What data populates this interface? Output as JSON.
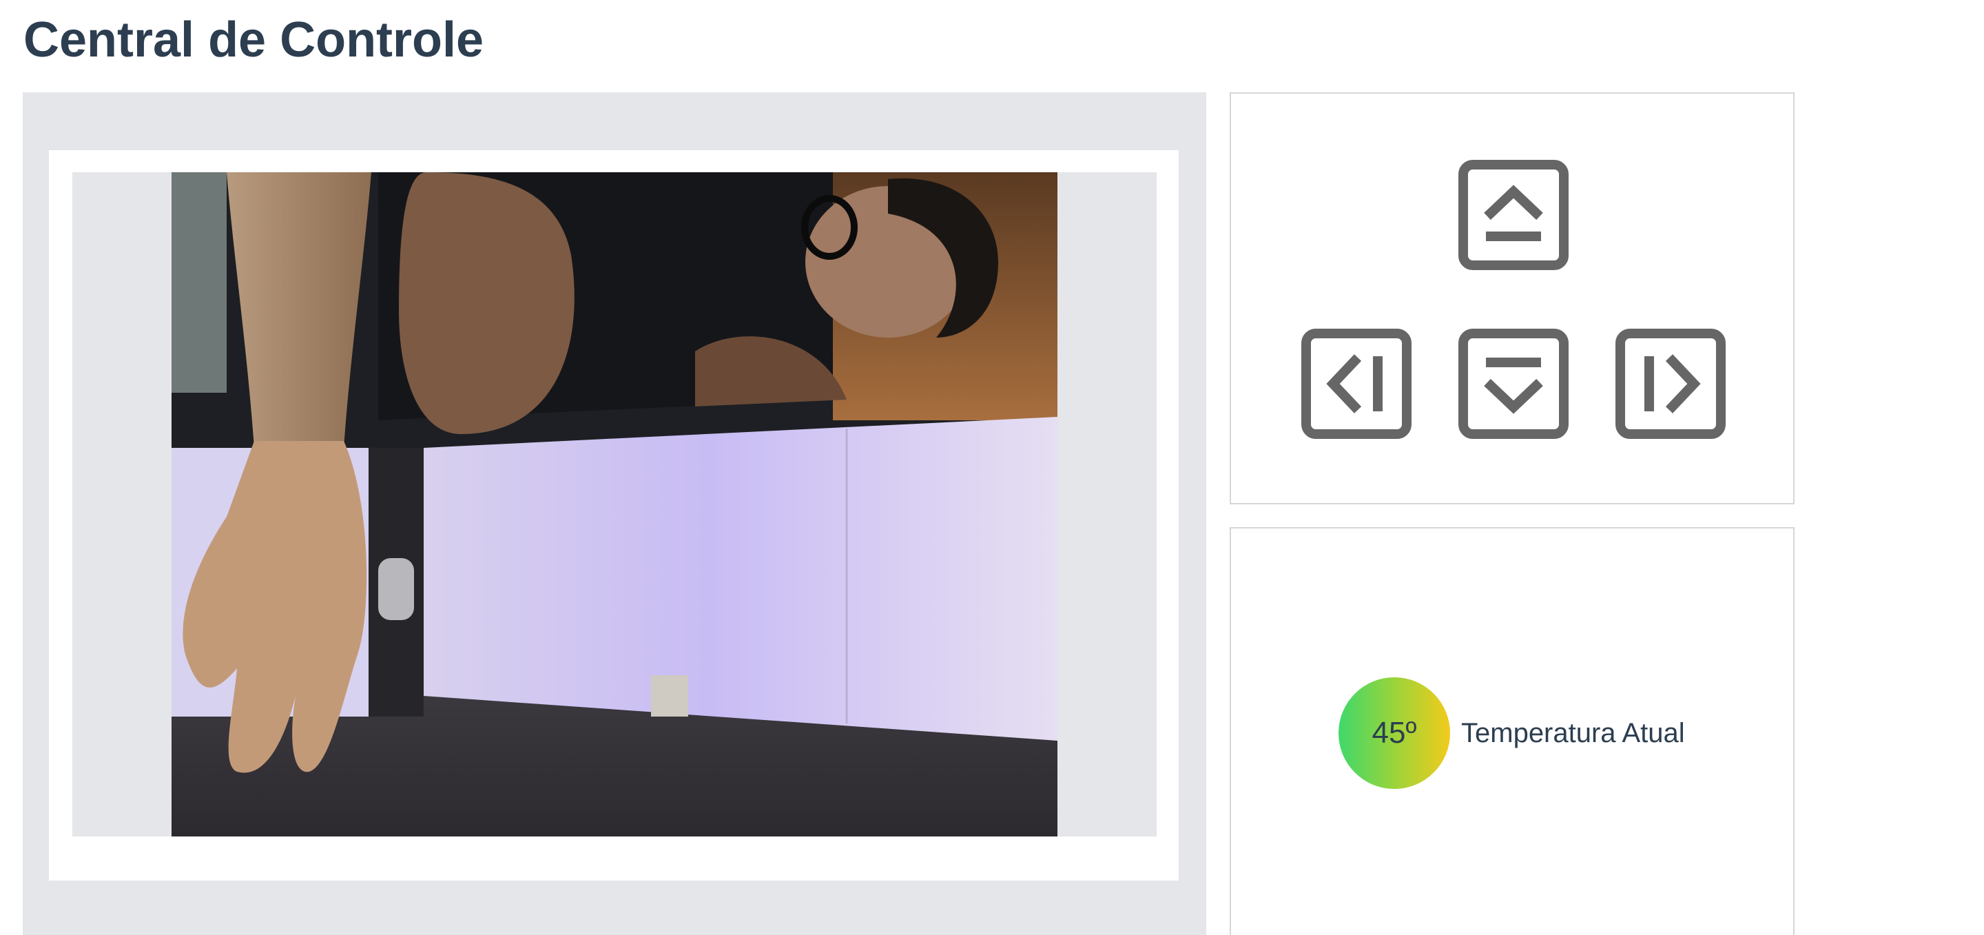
{
  "page": {
    "title": "Central de Controle"
  },
  "camera": {
    "label": "camera feed"
  },
  "controls": {
    "up_icon": "chevron-up-icon",
    "down_icon": "chevron-down-icon",
    "left_icon": "chevron-left-icon",
    "right_icon": "chevron-right-icon",
    "icon_color": "#666666"
  },
  "temperature": {
    "value": "45º",
    "label": "Temperatura Atual",
    "gradient": [
      "#3fd86a",
      "#f2cb1c"
    ]
  },
  "colors": {
    "title": "#2c3e50",
    "panel_bg": "#e5e6ea",
    "card_border": "#d6d6d6"
  }
}
